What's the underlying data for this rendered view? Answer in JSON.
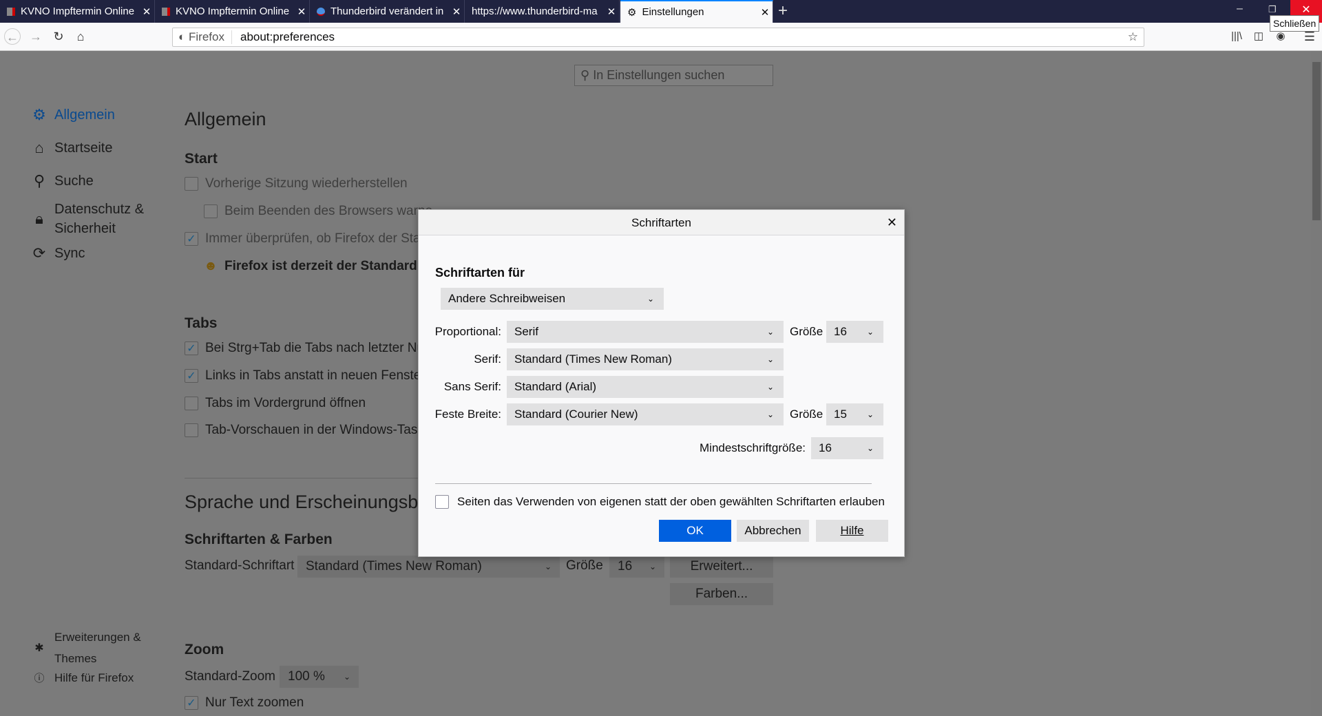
{
  "browser": {
    "tabs": [
      {
        "label": "KVNO Impftermin Online",
        "icon": "kvno-favicon"
      },
      {
        "label": "KVNO Impftermin Online",
        "icon": "kvno-favicon"
      },
      {
        "label": "Thunderbird verändert in",
        "icon": "thunderbird-favicon"
      },
      {
        "label": "https://www.thunderbird-ma",
        "icon": "none"
      },
      {
        "label": "Einstellungen",
        "icon": "gear-icon",
        "active": true
      }
    ],
    "url_identity": "Firefox",
    "url": "about:preferences",
    "tooltip": "Schließen"
  },
  "prefs": {
    "search_placeholder": "In Einstellungen suchen",
    "sidebar": [
      {
        "label": "Allgemein",
        "icon": "gear-icon",
        "active": true
      },
      {
        "label": "Startseite",
        "icon": "home-icon"
      },
      {
        "label": "Suche",
        "icon": "search-icon"
      },
      {
        "label": "Datenschutz &",
        "label2": "Sicherheit",
        "icon": "lock-icon"
      },
      {
        "label": "Sync",
        "icon": "sync-icon"
      }
    ],
    "sidebar_bottom": [
      {
        "label": "Erweiterungen &",
        "label2": "Themes",
        "icon": "puzzle-icon"
      },
      {
        "label": "Hilfe für Firefox",
        "icon": "help-icon"
      }
    ],
    "title": "Allgemein",
    "start": {
      "heading": "Start",
      "items": [
        {
          "label": "Vorherige Sitzung wiederherstellen",
          "checked": false
        },
        {
          "label": "Beim Beenden des Browsers warne",
          "checked": false
        },
        {
          "label": "Immer überprüfen, ob Firefox der Star",
          "checked": true
        },
        {
          "label": "Firefox ist derzeit der Standardbr"
        }
      ]
    },
    "tabs": {
      "heading": "Tabs",
      "items": [
        {
          "label": "Bei Strg+Tab die Tabs nach letzter Nut",
          "checked": true
        },
        {
          "label": "Links in Tabs anstatt in neuen Fenstern",
          "checked": true
        },
        {
          "label": "Tabs im Vordergrund öffnen",
          "checked": false
        },
        {
          "label": "Tab-Vorschauen in der Windows-Taskl",
          "checked": false
        }
      ]
    },
    "language_heading": "Sprache und Erscheinungsbild",
    "fonts": {
      "heading": "Schriftarten & Farben",
      "label": "Standard-Schriftart",
      "value": "Standard (Times New Roman)",
      "size_label": "Größe",
      "size": "16",
      "advanced": "Erweitert...",
      "colors": "Farben..."
    },
    "zoom": {
      "heading": "Zoom",
      "label": "Standard-Zoom",
      "value": "100 %",
      "text_only": "Nur Text zoomen",
      "text_only_checked": true
    }
  },
  "dialog": {
    "title": "Schriftarten",
    "for_label": "Schriftarten für",
    "for_value": "Andere Schreibweisen",
    "proportional_label": "Proportional:",
    "proportional_value": "Serif",
    "size_label": "Größe",
    "proportional_size": "16",
    "serif_label": "Serif:",
    "serif_value": "Standard (Times New Roman)",
    "sans_label": "Sans Serif:",
    "sans_value": "Standard (Arial)",
    "mono_label": "Feste Breite:",
    "mono_value": "Standard (Courier New)",
    "mono_size": "15",
    "min_label": "Mindestschriftgröße:",
    "min_value": "16",
    "allow_label": "Seiten das Verwenden von eigenen statt der oben gewählten Schriftarten erlauben",
    "allow_checked": false,
    "ok": "OK",
    "cancel": "Abbrechen",
    "help": "Hilfe",
    "accent": "#0060df"
  }
}
